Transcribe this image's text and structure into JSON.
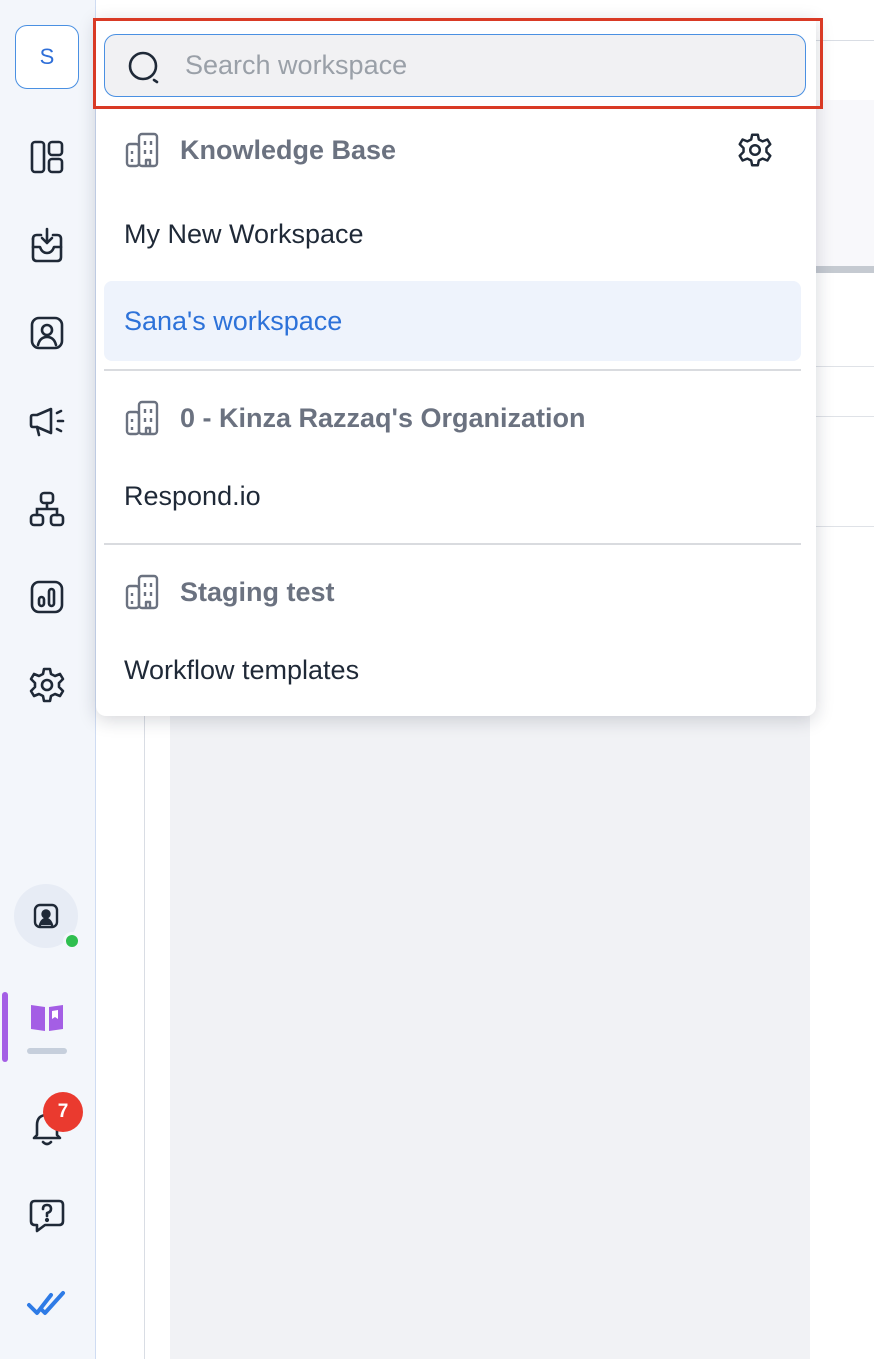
{
  "sidebar": {
    "workspace_initial": "S",
    "nav": [
      {
        "name": "dashboard-icon"
      },
      {
        "name": "inbox-icon"
      },
      {
        "name": "contacts-icon"
      },
      {
        "name": "broadcasts-icon"
      },
      {
        "name": "workflows-icon"
      },
      {
        "name": "reports-icon"
      },
      {
        "name": "settings-icon"
      }
    ],
    "notification_count": "7",
    "status_color": "#2fbf4f",
    "active_accent": "#a45ee5"
  },
  "search": {
    "placeholder": "Search workspace",
    "value": ""
  },
  "organizations": [
    {
      "name": "Knowledge Base",
      "has_settings": true,
      "workspaces": [
        "My New Workspace",
        "Sana's workspace"
      ],
      "selected": "Sana's workspace"
    },
    {
      "name": "0 - Kinza Razzaq's Organization",
      "workspaces": [
        "Respond.io"
      ]
    },
    {
      "name": "Staging test",
      "workspaces": [
        "Workflow templates"
      ]
    }
  ],
  "colors": {
    "accent_blue": "#2d72d9",
    "highlight_red": "#d93a25",
    "badge_red": "#ea3a2f"
  }
}
